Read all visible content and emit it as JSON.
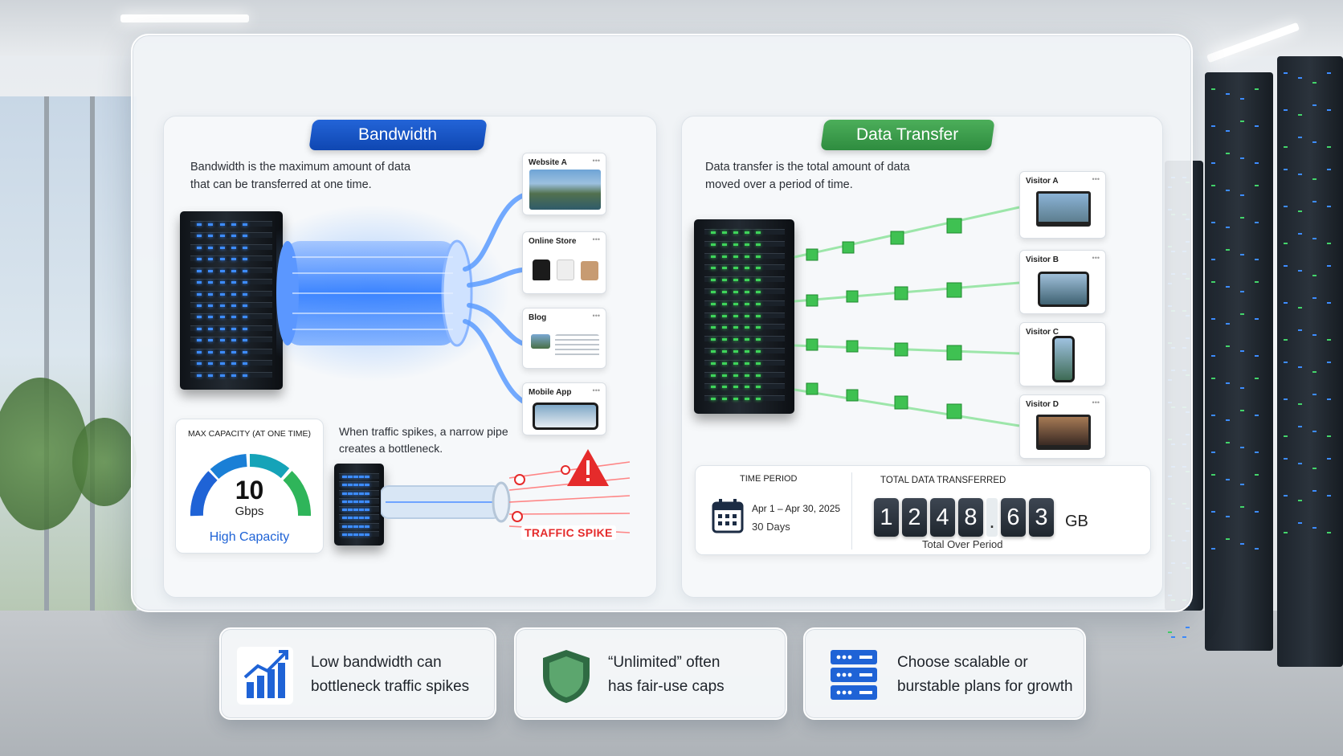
{
  "bandwidth": {
    "title": "Bandwidth",
    "description_line1": "Bandwidth is the maximum amount of data",
    "description_line2": "that can be transferred at one time.",
    "destinations": [
      "Website A",
      "Online Store",
      "Blog",
      "Mobile App"
    ],
    "gauge": {
      "label": "MAX CAPACITY (AT ONE TIME)",
      "value": "10",
      "unit": "Gbps",
      "caption": "High Capacity"
    },
    "spike_line1": "When traffic spikes, a narrow pipe",
    "spike_line2": "creates a bottleneck.",
    "spike_badge": "TRAFFIC SPIKE"
  },
  "data_transfer": {
    "title": "Data Transfer",
    "description_line1": "Data transfer is the total  amount of data",
    "description_line2": "moved over a period of time.",
    "visitors": [
      "Visitor A",
      "Visitor B",
      "Visitor C",
      "Visitor D"
    ],
    "time_period_label": "TIME PERIOD",
    "time_period_range": "Apr 1 – Apr 30, 2025",
    "time_period_days": "30 Days",
    "total_label": "TOTAL DATA TRANSFERRED",
    "digits": [
      "1",
      "2",
      "4",
      "8",
      ".",
      "6",
      "3"
    ],
    "total_unit": "GB",
    "total_caption": "Total Over Period"
  },
  "features": [
    {
      "line1": "Low bandwidth can",
      "line2": "bottleneck traffic spikes",
      "icon": "chart-growth-icon"
    },
    {
      "line1": "“Unlimited” often",
      "line2": "has fair-use caps",
      "icon": "shield-icon"
    },
    {
      "line1": "Choose scalable or",
      "line2": "burstable plans for growth",
      "icon": "server-stack-icon"
    }
  ],
  "colors": {
    "bandwidth_blue": "#1550c4",
    "transfer_green": "#3a9c4b",
    "alert_red": "#e52b2b"
  }
}
